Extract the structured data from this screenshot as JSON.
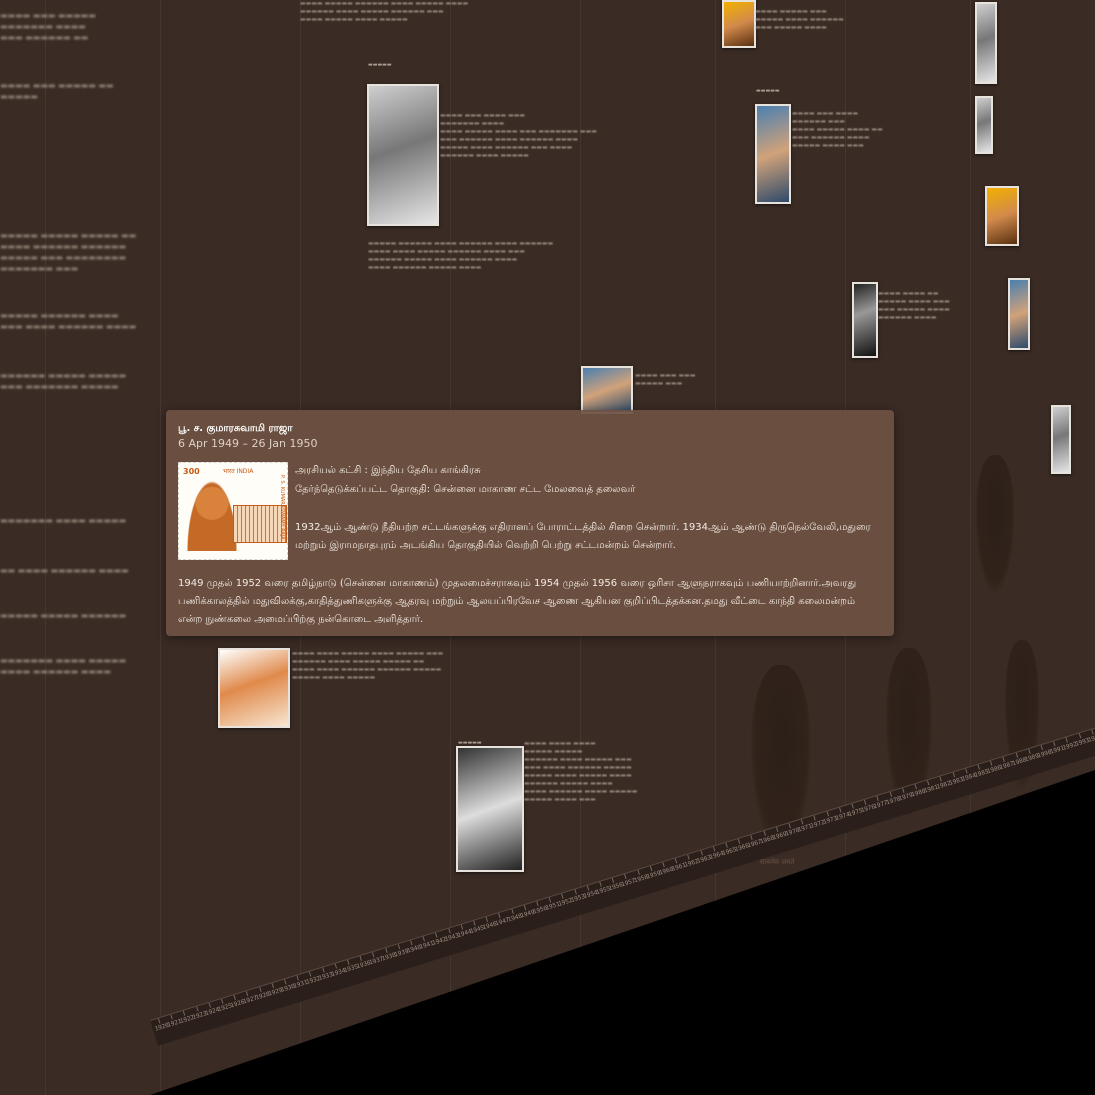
{
  "popup": {
    "name": "பூ. ச. குமாரசுவாமி ராஜா",
    "term": "6 Apr 1949 – 26 Jan 1950",
    "party": "அரசியல் கட்சி : இந்திய தேசிய காங்கிரசு",
    "constituency": "தேர்ந்தெடுக்கப்பட்ட தொகுதி: சென்னை மாகாண சட்ட மேலவைத் தலைவர்",
    "bio_1": "1932ஆம் ஆண்டு நீதியற்ற சட்டங்களுக்கு எதிரானப் போராட்டத்தில் சிறை சென்றார். 1934ஆம் ஆண்டு திருநெல்வேலி,மதுரை மற்றும் இராமநாதபுரம் அடங்கிய தொகுதியில் வெற்றி பெற்று சட்டமன்றம் சென்றார்.",
    "bio_2": "1949 முதல் 1952 வரை தமிழ்நாடு (சென்னை மாகாணம்) முதலமைச்சராகவும் 1954 முதல் 1956 வரை ஒரிசா ஆளுநராகவும் பணியாற்றினார்.அவரது பணிக்காலத்தில் மதுவிலக்கு,காதித்துணிகளுக்கு ஆதரவு மற்றும் ஆலயப்பிரவேச ஆணை ஆகியன குறிப்பிடத்தக்கன.தமது வீட்டை காந்தி கலைமன்றம் என்ற நுண்கலை அமைப்பிற்கு நன்கொடை அளித்தார்.",
    "stamp": {
      "value": "300",
      "country": "भारत INDIA",
      "name_on_stamp": "P. S. KUMARASWAMY RAJA"
    }
  },
  "axis_years": [
    "1920",
    "1921",
    "1922",
    "1923",
    "1924",
    "1925",
    "1926",
    "1927",
    "1928",
    "1929",
    "1930",
    "1931",
    "1932",
    "1933",
    "1934",
    "1935",
    "1936",
    "1937",
    "1938",
    "1939",
    "1940",
    "1941",
    "1942",
    "1943",
    "1944",
    "1945",
    "1946",
    "1947",
    "1948",
    "1949",
    "1950",
    "1951",
    "1952",
    "1953",
    "1954",
    "1955",
    "1956",
    "1957",
    "1958",
    "1959",
    "1960",
    "1961",
    "1962",
    "1963",
    "1964",
    "1965",
    "1966",
    "1967",
    "1968",
    "1969",
    "1970",
    "1971",
    "1972",
    "1973",
    "1974",
    "1975",
    "1976",
    "1977",
    "1978",
    "1979",
    "1980",
    "1981",
    "1982",
    "1983",
    "1984",
    "1985",
    "1986",
    "1987",
    "1988",
    "1989",
    "1990",
    "1991",
    "1992",
    "1993",
    "1994",
    "1995",
    "1996"
  ],
  "emblem_caption": "सत्यमेव जयते",
  "colors": {
    "wall": "#3a2b24",
    "popup": "#6e5244",
    "text": "#f3ebe4"
  }
}
